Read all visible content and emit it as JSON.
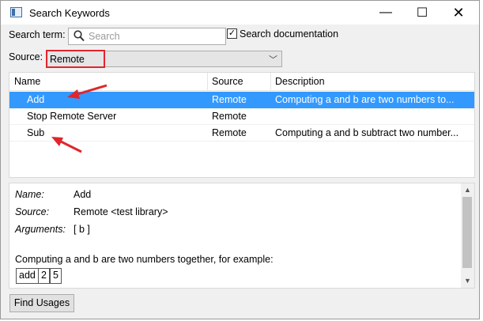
{
  "window": {
    "title": "Search Keywords",
    "controls": {
      "minimize": "—",
      "maximize": "☐",
      "close": "✕"
    }
  },
  "search": {
    "label": "Search term:",
    "placeholder": "Search",
    "value": "",
    "search_doc_label": "Search documentation",
    "search_doc_checked": true
  },
  "source": {
    "label": "Source:",
    "selected": "Remote"
  },
  "table": {
    "columns": [
      "Name",
      "Source",
      "Description"
    ],
    "rows": [
      {
        "name": "Add",
        "source": "Remote",
        "description": "Computing a and b are two numbers to...",
        "selected": true
      },
      {
        "name": "Stop Remote Server",
        "source": "Remote",
        "description": "",
        "selected": false
      },
      {
        "name": "Sub",
        "source": "Remote",
        "description": "Computing a and b subtract two number...",
        "selected": false
      }
    ]
  },
  "details": {
    "name_label": "Name:",
    "name_value": "Add",
    "source_label": "Source:",
    "source_value": "Remote <test library>",
    "args_label": "Arguments:",
    "args_value": "[ b ]",
    "doc": "Computing a and b are two numbers together, for example:",
    "example": [
      "add",
      "2",
      "5"
    ]
  },
  "buttons": {
    "find_usages": "Find Usages"
  },
  "colors": {
    "selection": "#3399ff",
    "annotation": "#e0262d"
  }
}
